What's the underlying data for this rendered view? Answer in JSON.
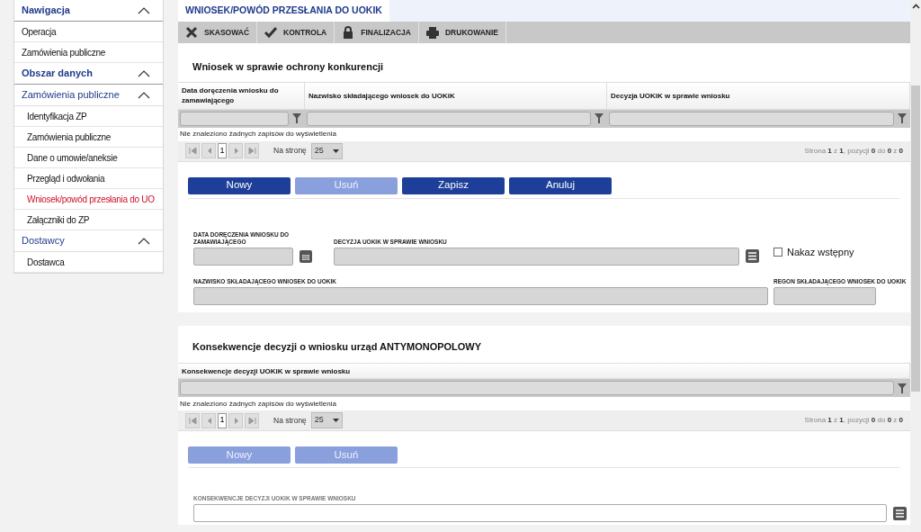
{
  "sidebar": {
    "groups": [
      {
        "label": "Nawigacja",
        "kind": "header",
        "expanded": true,
        "children": [
          {
            "label": "Operacja",
            "selected": false
          },
          {
            "label": "Zamówienia publiczne",
            "selected": false
          }
        ]
      },
      {
        "label": "Obszar danych",
        "kind": "header",
        "expanded": true,
        "children": [
          {
            "label": "Zamówienia publiczne",
            "kind": "group",
            "expanded": true,
            "children": [
              {
                "label": "Identyfikacja ZP",
                "selected": false
              },
              {
                "label": "Zamówienia publiczne",
                "selected": false
              },
              {
                "label": "Dane o umowie/aneksie",
                "selected": false
              },
              {
                "label": "Przegląd i odwołania",
                "selected": false
              },
              {
                "label": "Wniosek/powód przesłania do UO",
                "selected": true
              },
              {
                "label": "Załączniki do ZP",
                "selected": false
              }
            ]
          },
          {
            "label": "Dostawcy",
            "kind": "group",
            "expanded": true,
            "children": [
              {
                "label": "Dostawca",
                "selected": false
              }
            ]
          }
        ]
      }
    ]
  },
  "tabs": [
    {
      "label": "WNIOSEK/POWÓD PRZESŁANIA DO UOKIK",
      "selected": true
    }
  ],
  "toolbar": [
    {
      "label": "SKASOWAĆ"
    },
    {
      "label": "KONTROLA"
    },
    {
      "label": "FINALIZACJA"
    },
    {
      "label": "DRUKOWANIE"
    }
  ],
  "sections": [
    {
      "title": "Wniosek w sprawie ochrony konkurencji",
      "table": {
        "columns": [
          "Data doręczenia wniosku do zamawiającego",
          "Nazwisko składającego wniosek do UOKiK",
          "Decyzja UOKiK w sprawie wniosku"
        ],
        "empty_message": "Nie znaleziono żadnych zapisów do wyświetlenia",
        "pager": {
          "page": "1",
          "per_page_label": "Na stronę",
          "per_page": "25",
          "summary": "Strona **1** z **1**, pozycji **0** do **0** z **0**"
        }
      },
      "buttons": [
        {
          "label": "Nowy",
          "disabled": false
        },
        {
          "label": "Usuń",
          "disabled": true
        },
        {
          "label": "Zapisz",
          "disabled": false
        },
        {
          "label": "Anuluj",
          "disabled": false
        }
      ],
      "form_rows": [
        [
          {
            "kind": "date",
            "label": "DATA DORĘCZENIA WNIOSKU DO ZAMAWIAJĄCEGO",
            "disabled": true
          },
          {
            "kind": "select",
            "label": "DECYZJA UOKIK W SPRAWIE WNIOSKU",
            "disabled": true
          },
          {
            "kind": "checkbox",
            "label": "Nakaz wstępny",
            "checked": false
          }
        ],
        [
          {
            "kind": "text",
            "label": "NAZWISKO SKŁADAJĄCEGO WNIOSEK DO UOKIK",
            "disabled": true
          },
          {
            "kind": "short",
            "label": "REGON SKŁADAJĄCEGO WNIOSEK DO UOKIK",
            "disabled": true
          }
        ]
      ]
    },
    {
      "title": "Konsekwencje decyzji o wniosku urząd ANTYMONOPOLOWY",
      "table": {
        "columns": [
          "Konsekwencje decyzji UOKiK w sprawie wniosku"
        ],
        "empty_message": "Nie znaleziono żadnych zapisów do wyświetlenia",
        "pager": {
          "page": "1",
          "per_page_label": "Na stronę",
          "per_page": "25",
          "summary": "Strona **1** z **1**, pozycji **0** do **0** z **0**"
        }
      },
      "buttons": [
        {
          "label": "Nowy",
          "disabled": true
        },
        {
          "label": "Usuń",
          "disabled": true
        }
      ],
      "form_rows": [
        [
          {
            "kind": "select",
            "label": "KONSEKWENCJE DECYZJI UOKIK W SPRAWIE WNIOSKU",
            "disabled": false
          }
        ]
      ]
    }
  ]
}
